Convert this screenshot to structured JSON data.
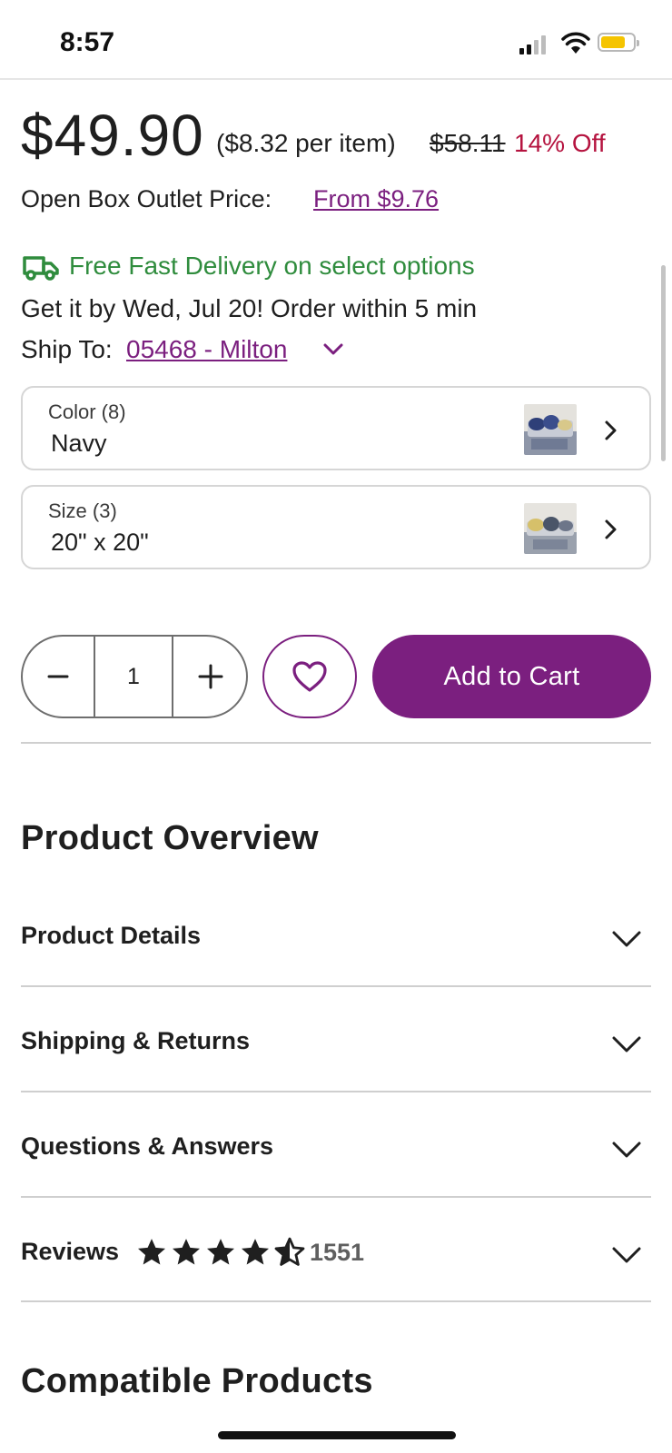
{
  "status_bar": {
    "time": "8:57",
    "battery_color": "#f5c400"
  },
  "pricing": {
    "price": "$49.90",
    "per_item": "($8.32 per item)",
    "original_price": "$58.11",
    "discount": "14% Off",
    "outlet_label": "Open Box Outlet Price:",
    "outlet_link": "From $9.76"
  },
  "delivery": {
    "icon": "truck-icon",
    "headline": "Free Fast Delivery on select options",
    "get_by": "Get it by Wed, Jul 20! Order within 5 min",
    "ship_to_label": "Ship To:",
    "ship_to_link": "05468 - Milton"
  },
  "options": [
    {
      "label": "Color (8)",
      "value": "Navy"
    },
    {
      "label": "Size (3)",
      "value": "20\" x 20\""
    }
  ],
  "cart": {
    "quantity": "1",
    "add_to_cart": "Add to Cart",
    "accent_color": "#7b1f7f"
  },
  "overview": {
    "title": "Product Overview",
    "sections": [
      {
        "title": "Product Details"
      },
      {
        "title": "Shipping & Returns"
      },
      {
        "title": "Questions & Answers"
      },
      {
        "title": "Reviews",
        "rating": 4.5,
        "review_count": "1551"
      }
    ]
  },
  "next_section": {
    "title": "Compatible Products"
  },
  "colors": {
    "link": "#7b1f7f",
    "delivery_green": "#2f8c3d",
    "discount_red": "#b5133f"
  }
}
